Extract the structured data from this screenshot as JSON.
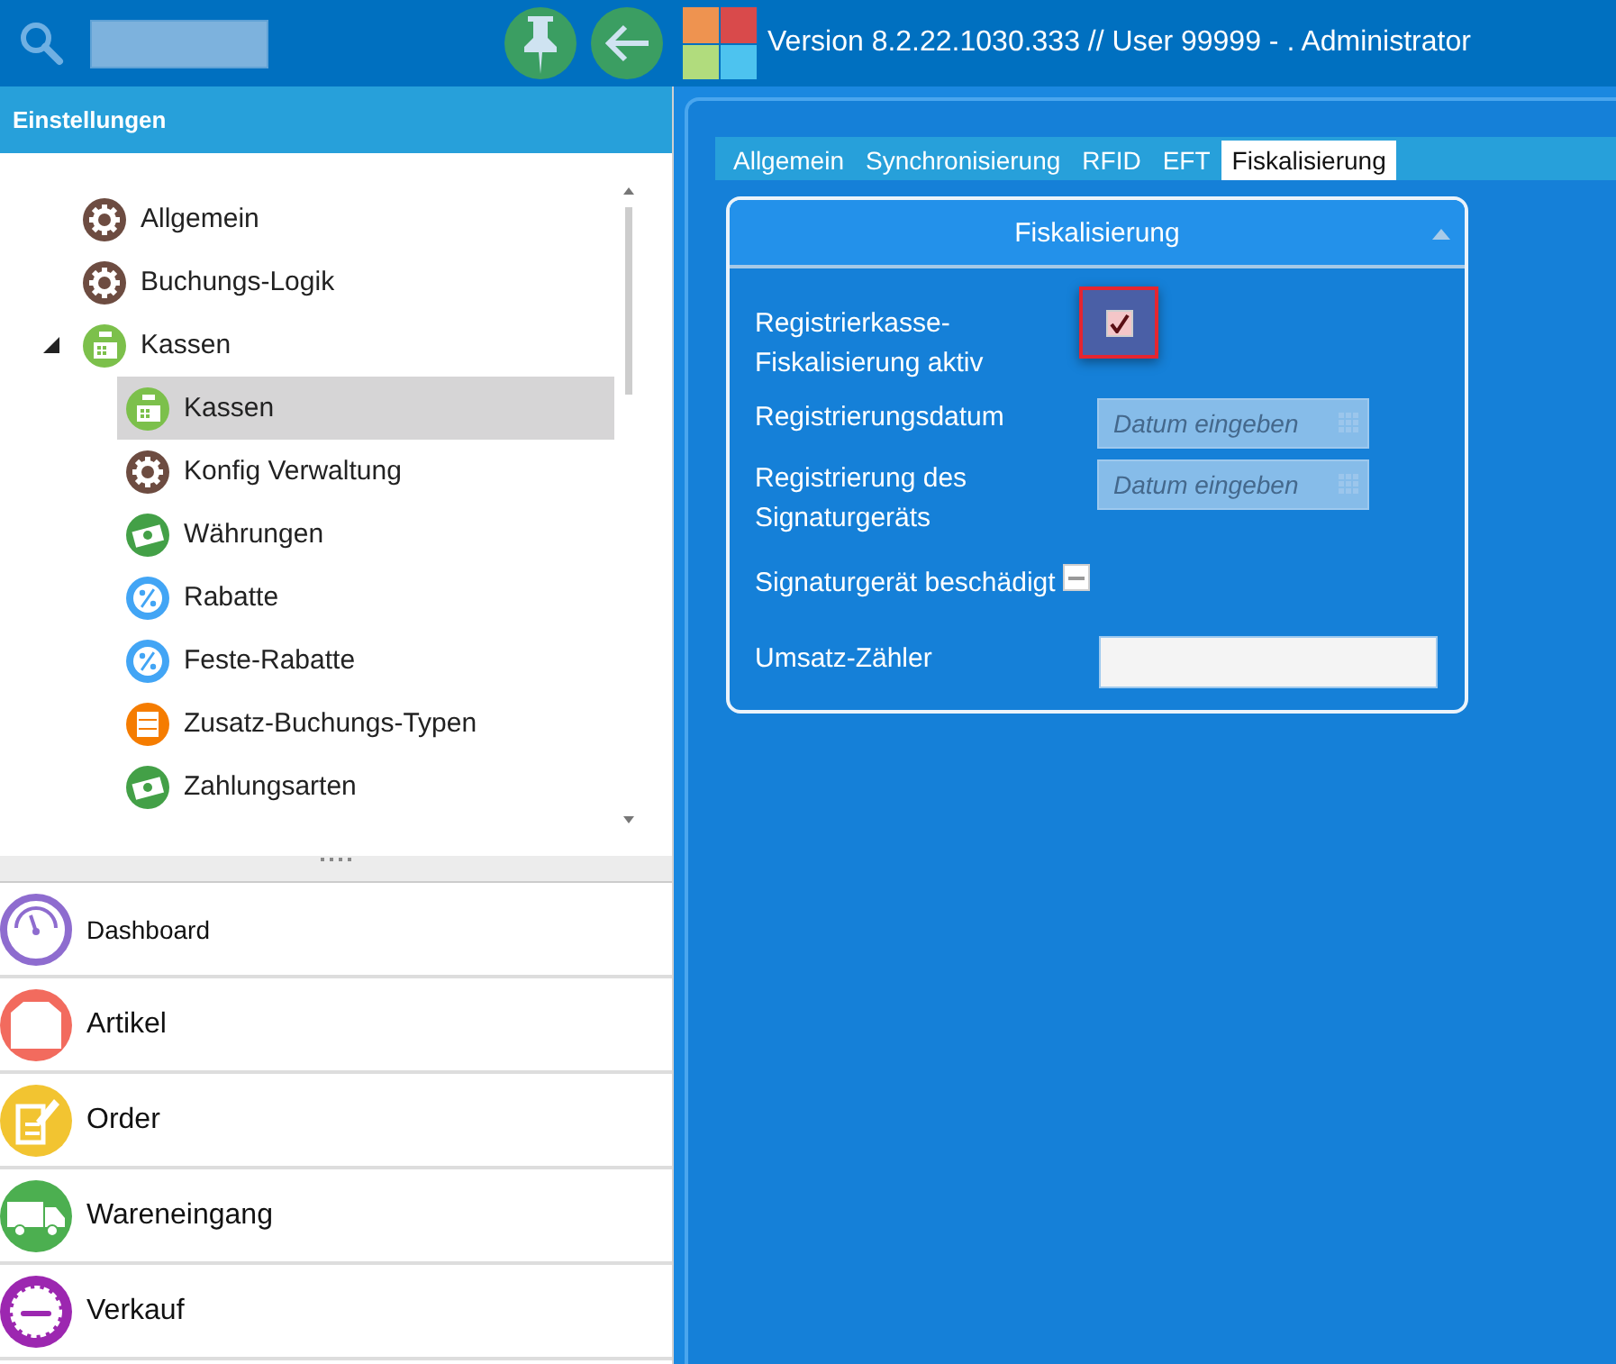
{
  "topbar": {
    "version": "Version 8.2.22.1030.333  //  User 99999 - . Administrator"
  },
  "sidebar": {
    "title": "Einstellungen",
    "tree": [
      {
        "label": "Allgemein",
        "kind": "gear",
        "selected": false
      },
      {
        "label": "Buchungs-Logik",
        "kind": "gear",
        "selected": false
      },
      {
        "label": "Kassen",
        "kind": "register",
        "selected": false,
        "expanded": true,
        "children": [
          {
            "label": "Kassen",
            "kind": "register",
            "selected": true
          },
          {
            "label": "Konfig  Verwaltung",
            "kind": "gear",
            "selected": false
          },
          {
            "label": "Währungen",
            "kind": "money",
            "selected": false
          },
          {
            "label": "Rabatte",
            "kind": "percent",
            "selected": false
          },
          {
            "label": "Feste-Rabatte",
            "kind": "percent",
            "selected": false
          },
          {
            "label": "Zusatz-Buchungs-Typen",
            "kind": "drawer",
            "selected": false
          },
          {
            "label": "Zahlungsarten",
            "kind": "money",
            "selected": false
          }
        ]
      }
    ],
    "nav": [
      {
        "label": "Dashboard",
        "kind": "gauge",
        "color": "#8e6ccf"
      },
      {
        "label": "Artikel",
        "kind": "shirt",
        "color": "#f26b5e"
      },
      {
        "label": "Order",
        "kind": "note",
        "color": "#f2c431"
      },
      {
        "label": "Wareneingang",
        "kind": "truck",
        "color": "#4caf50"
      },
      {
        "label": "Verkauf",
        "kind": "sale",
        "color": "#9c27b0"
      }
    ]
  },
  "settings": {
    "tabs": [
      {
        "label": "Allgemein",
        "selected": false
      },
      {
        "label": "Synchronisierung",
        "selected": false
      },
      {
        "label": "RFID",
        "selected": false
      },
      {
        "label": "EFT",
        "selected": false
      },
      {
        "label": "Fiskalisierung",
        "selected": true
      }
    ],
    "group": {
      "title": "Fiskalisierung",
      "expanded": true,
      "fields": [
        {
          "kind": "checkbox",
          "label": "Registrierkasse-\nFiskalisierung aktiv",
          "checked": true,
          "focused": true
        },
        {
          "kind": "date",
          "label": "Registrierungsdatum",
          "placeholder": "Datum eingeben"
        },
        {
          "kind": "date",
          "label": "Registrierung des\nSignaturgeräts",
          "placeholder": "Datum eingeben"
        },
        {
          "kind": "checkbox",
          "label": "Signaturgerät beschädigt",
          "indeterminate": true
        },
        {
          "kind": "text",
          "label": "Umsatz-Zähler"
        }
      ]
    }
  }
}
